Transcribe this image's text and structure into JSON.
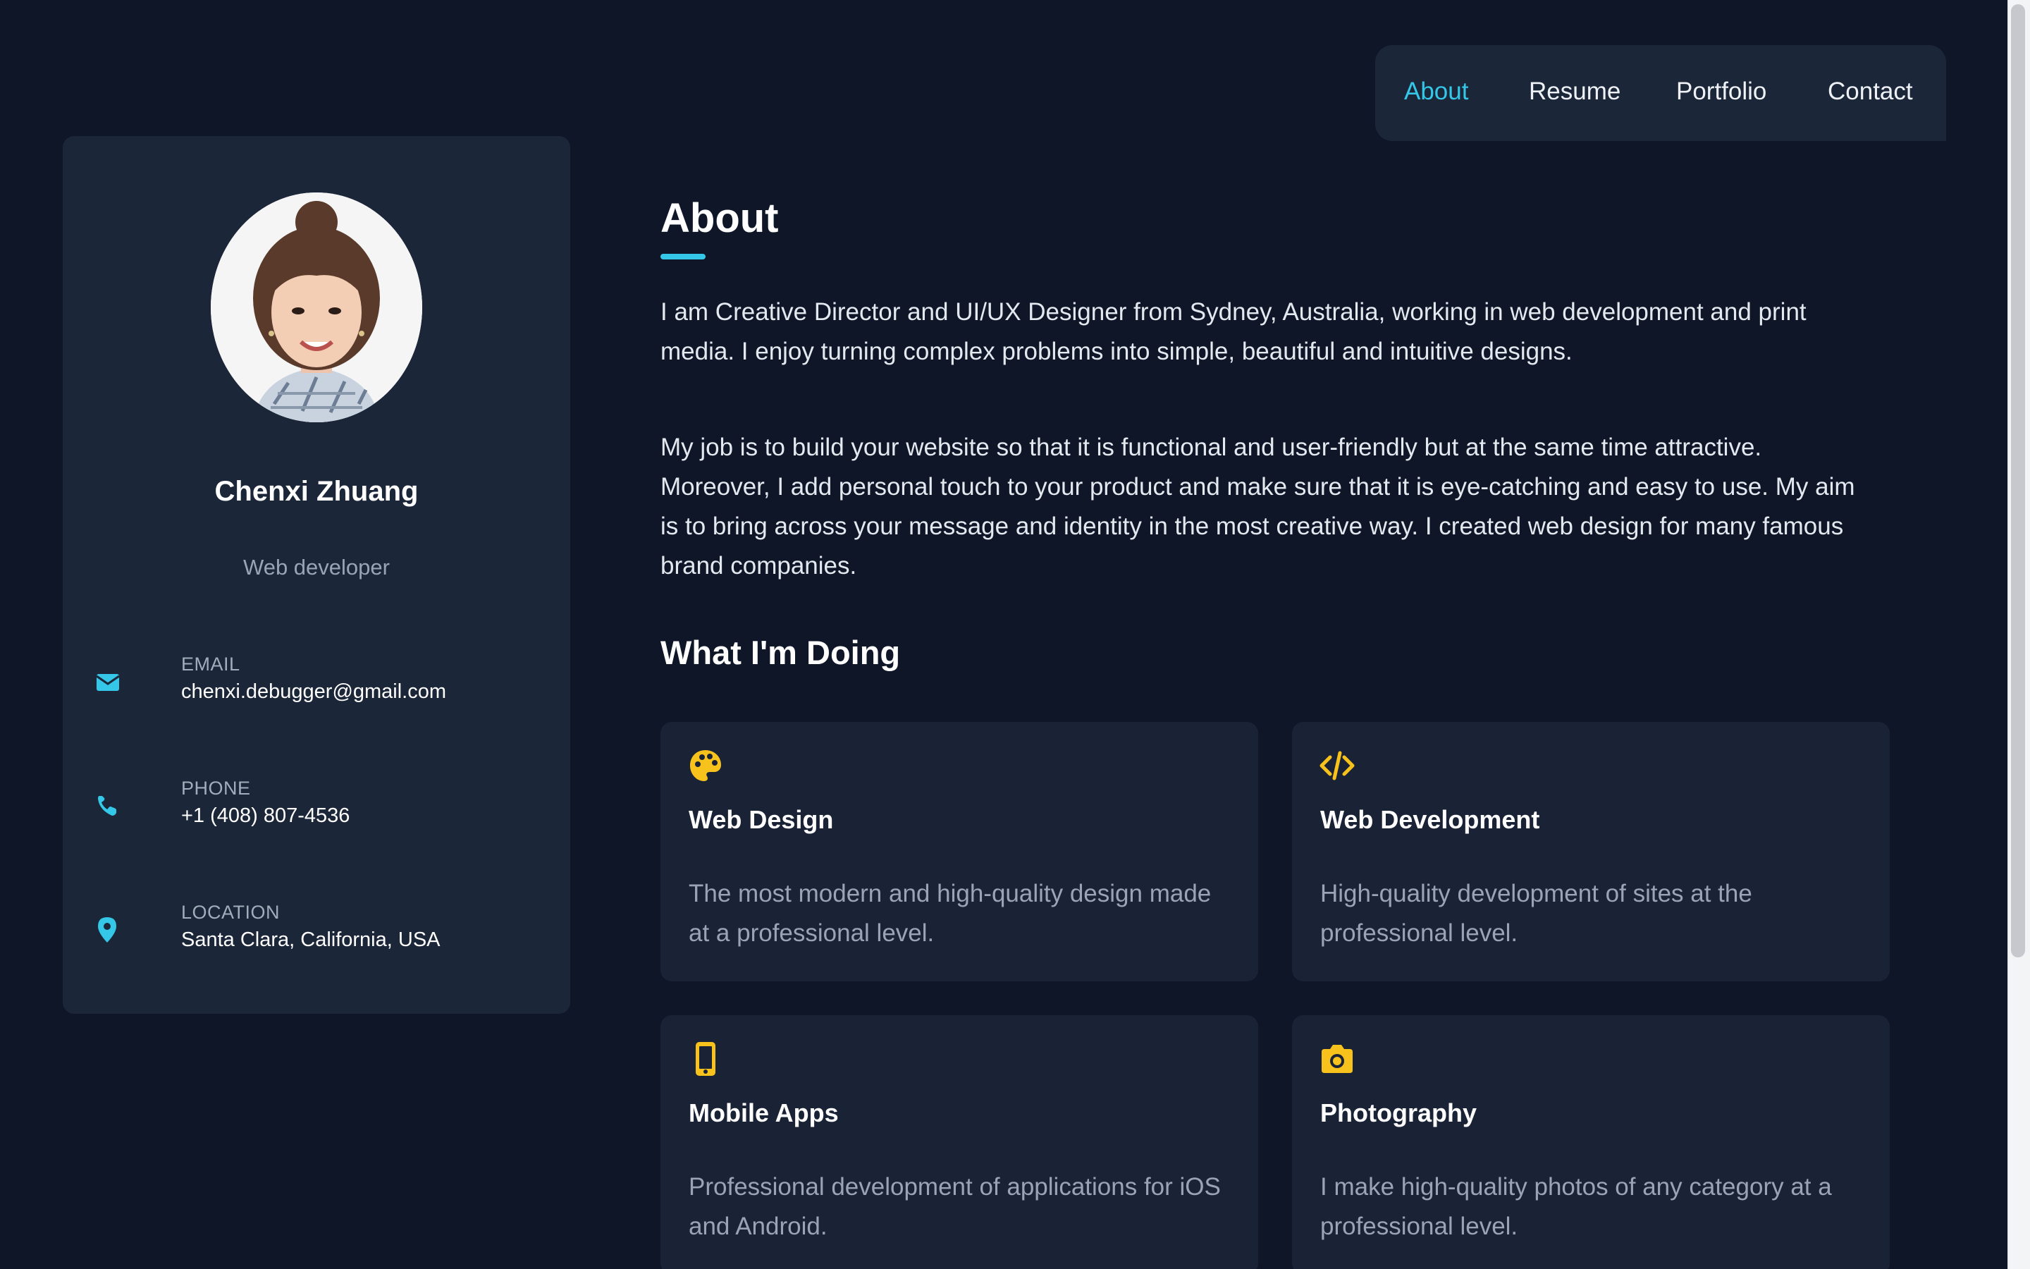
{
  "colors": {
    "background": "#0e1628",
    "card": "#1c2639",
    "accent": "#35c7e8",
    "icon_yellow": "#f8c21c",
    "muted_text": "#9aa4b5"
  },
  "navbar": {
    "items": [
      {
        "label": "About",
        "active": true
      },
      {
        "label": "Resume",
        "active": false
      },
      {
        "label": "Portfolio",
        "active": false
      },
      {
        "label": "Contact",
        "active": false
      }
    ]
  },
  "sidebar": {
    "avatar_icon": "profile-photo",
    "name": "Chenxi Zhuang",
    "role": "Web developer",
    "contacts": [
      {
        "icon": "envelope-icon",
        "label": "EMAIL",
        "value": "chenxi.debugger@gmail.com"
      },
      {
        "icon": "phone-icon",
        "label": "PHONE",
        "value": "+1 (408) 807-4536"
      },
      {
        "icon": "map-pin-icon",
        "label": "LOCATION",
        "value": "Santa Clara, California, USA"
      }
    ]
  },
  "main": {
    "title": "About",
    "paragraphs": [
      "I am Creative Director and UI/UX Designer from Sydney, Australia, working in web development and print media. I enjoy turning complex problems into simple, beautiful and intuitive designs.",
      "My job is to build your website so that it is functional and user-friendly but at the same time attractive. Moreover, I add personal touch to your product and make sure that it is eye-catching and easy to use. My aim is to bring across your message and identity in the most creative way. I created web design for many famous brand companies."
    ],
    "section_title": "What I'm Doing",
    "services": [
      {
        "icon": "palette-icon",
        "title": "Web Design",
        "description": "The most modern and high-quality design made at a professional level."
      },
      {
        "icon": "code-icon",
        "title": "Web Development",
        "description": "High-quality development of sites at the professional level."
      },
      {
        "icon": "mobile-icon",
        "title": "Mobile Apps",
        "description": "Professional development of applications for iOS and Android."
      },
      {
        "icon": "camera-icon",
        "title": "Photography",
        "description": "I make high-quality photos of any category at a professional level."
      }
    ]
  }
}
